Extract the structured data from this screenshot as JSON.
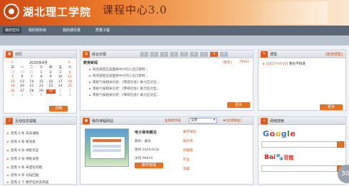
{
  "header": {
    "school_name": "湖北理工学院",
    "center_title": "课程中心3.0"
  },
  "nav": {
    "items": [
      "我的空间",
      "我的资料库",
      "我的通讯录",
      "质量工程"
    ]
  },
  "calendar": {
    "title": "日历",
    "month_label": "2020年4月",
    "prev": "<",
    "next": ">",
    "weekdays": [
      "日",
      "一",
      "二",
      "三",
      "四",
      "五",
      "六"
    ],
    "rows": [
      [
        "29",
        "30",
        "31",
        "1",
        "2",
        "3",
        "4"
      ],
      [
        "5",
        "6",
        "7",
        "8",
        "9",
        "10",
        "11"
      ],
      [
        "12",
        "13",
        "14",
        "15",
        "16",
        "17",
        "18"
      ],
      [
        "19",
        "20",
        "21",
        "22",
        "23",
        "24",
        "25"
      ],
      [
        "26",
        "27",
        "28",
        "29",
        "30",
        "1",
        "2"
      ],
      [
        "3",
        "4",
        "5",
        "6",
        "7",
        "8",
        "9"
      ]
    ],
    "detail_button": "详细"
  },
  "news": {
    "title": "综合日报",
    "pager": [
      "1",
      "2",
      "3",
      "4",
      "5",
      "6",
      "7",
      "8",
      "9"
    ],
    "subtitle": "教育新闻",
    "links": [
      "[更多]",
      "[RSS]"
    ],
    "items": [
      "商务部回应美国将中兴列入出口管制...",
      "商务部回应美国将中兴列入出口管制...",
      "南极气候相关论述：《零碳社会》助力应对全...",
      "南极气候相关论述：《零碳社会》助力应对全...",
      "南极气候相关论述：《零碳社会》助力应对全..."
    ],
    "more_button": "更多"
  },
  "notes": {
    "title": "便签",
    "link": "[新增便签]",
    "entry_date": "[2017-04-03]",
    "entry_text": "我也不知道",
    "more_button": "更多"
  },
  "interaction": {
    "title": "互动信息提醒",
    "items": [
      "您有 0 条 未读通知",
      "您有 0 条 新消息",
      "您有 0 份 待批作业",
      "您有 0 份 待批试卷",
      "您有 0 条 未回答问题",
      "您有 0 条 论坛回复",
      "您有 0 个 教学任务未完成"
    ]
  },
  "course": {
    "title": "我的课程网站",
    "view_link": "查看教学班",
    "select_value": "全部",
    "create_link": "[创建网站]",
    "name": "电子商务概论",
    "teacher": "教师：桑剑",
    "updated": "更新:2020/4/18",
    "visits": "访问:96814",
    "manage_button": "教学管理",
    "side_links": [
      "教学资料",
      "知识点",
      "问题库",
      "作业",
      "答疑"
    ]
  },
  "search": {
    "title": "网络搜索",
    "google_text": "Google",
    "baidu_text": "Bai度百度"
  },
  "scroll_badge": "30"
}
